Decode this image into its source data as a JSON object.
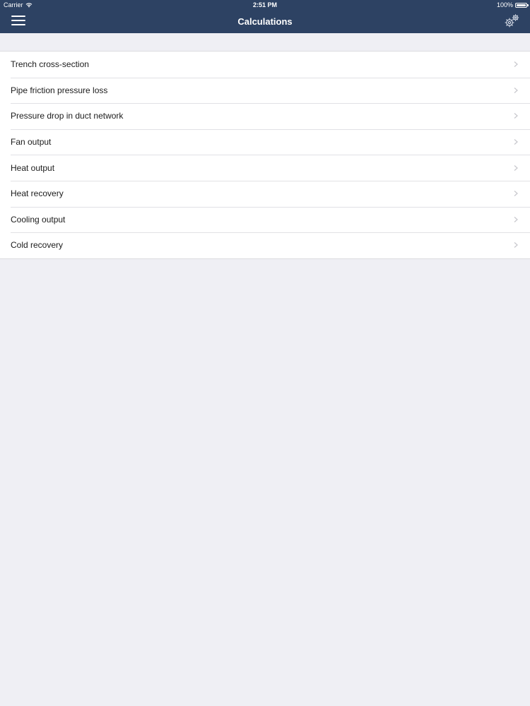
{
  "status_bar": {
    "carrier": "Carrier",
    "time": "2:51 PM",
    "battery": "100%",
    "wifi_icon": "wifi-icon"
  },
  "nav": {
    "title": "Calculations",
    "menu_icon": "hamburger-menu-icon",
    "settings_icon": "gears-icon"
  },
  "list": {
    "items": [
      {
        "label": "Trench cross-section"
      },
      {
        "label": "Pipe friction pressure loss"
      },
      {
        "label": "Pressure drop in duct network"
      },
      {
        "label": "Fan output"
      },
      {
        "label": "Heat output"
      },
      {
        "label": "Heat recovery"
      },
      {
        "label": "Cooling output"
      },
      {
        "label": "Cold recovery"
      }
    ],
    "chevron_icon": "chevron-right-icon"
  },
  "colors": {
    "navbar": "#2d4263",
    "background": "#efeff4",
    "row_background": "#ffffff",
    "chevron": "#c7c7cc"
  }
}
